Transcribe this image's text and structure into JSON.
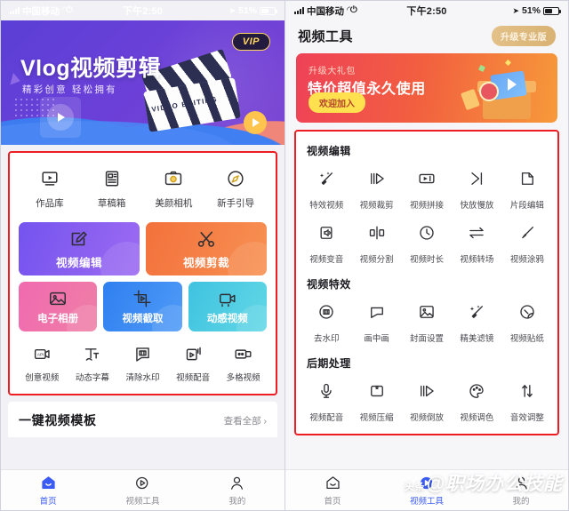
{
  "status_bar": {
    "carrier": "中国移动",
    "time": "下午2:50",
    "battery": "51%"
  },
  "left_screen": {
    "hero": {
      "title": "Vlog视频剪辑",
      "subtitle": "精彩创意 轻松拥有",
      "vip_badge": "VIP",
      "clapper_label": "VIDEO EDITING"
    },
    "quick_actions": [
      {
        "label": "作品库",
        "icon": "video-library-icon"
      },
      {
        "label": "草稿箱",
        "icon": "draft-box-icon"
      },
      {
        "label": "美颜相机",
        "icon": "beauty-camera-icon"
      },
      {
        "label": "新手引导",
        "icon": "compass-guide-icon"
      }
    ],
    "big_cards": [
      {
        "label": "视频编辑",
        "icon": "edit-pencil-icon",
        "color": "#7453ef"
      },
      {
        "label": "视频剪裁",
        "icon": "scissors-icon",
        "color": "#f3713c"
      }
    ],
    "mid_cards": [
      {
        "label": "电子相册",
        "icon": "photo-album-icon",
        "color": "#f06ab0"
      },
      {
        "label": "视频截取",
        "icon": "video-capture-icon",
        "color": "#2f7ff0"
      },
      {
        "label": "动感视频",
        "icon": "dynamic-video-icon",
        "color": "#3fc3e0"
      }
    ],
    "small_actions": [
      {
        "label": "创意视频",
        "icon": "creative-video-icon"
      },
      {
        "label": "动态字幕",
        "icon": "dynamic-subtitle-icon"
      },
      {
        "label": "清除水印",
        "icon": "remove-watermark-icon"
      },
      {
        "label": "视频配音",
        "icon": "video-dubbing-icon"
      },
      {
        "label": "多格视频",
        "icon": "multi-frame-video-icon"
      }
    ],
    "section": {
      "title": "一键视频模板",
      "more": "查看全部 ›"
    },
    "tabbar": [
      {
        "label": "首页",
        "icon": "home-icon",
        "active": true
      },
      {
        "label": "视频工具",
        "icon": "video-tools-icon",
        "active": false
      },
      {
        "label": "我的",
        "icon": "profile-icon",
        "active": false
      }
    ]
  },
  "right_screen": {
    "header": {
      "title": "视频工具",
      "upgrade_button": "升级专业版"
    },
    "promo": {
      "eyebrow": "升级大礼包",
      "headline": "特价超值永久使用",
      "button": "欢迎加入"
    },
    "groups": [
      {
        "title": "视频编辑",
        "items": [
          {
            "label": "特效视频",
            "icon": "magic-wand-icon"
          },
          {
            "label": "视频裁剪",
            "icon": "video-trim-icon"
          },
          {
            "label": "视频拼接",
            "icon": "video-merge-icon"
          },
          {
            "label": "快放慢放",
            "icon": "speed-icon"
          },
          {
            "label": "片段编辑",
            "icon": "clip-edit-icon"
          },
          {
            "label": "视频变音",
            "icon": "voice-change-icon"
          },
          {
            "label": "视频分割",
            "icon": "video-split-icon"
          },
          {
            "label": "视频时长",
            "icon": "clock-duration-icon"
          },
          {
            "label": "视频转场",
            "icon": "transition-icon"
          },
          {
            "label": "视频涂鸦",
            "icon": "brush-doodle-icon"
          }
        ]
      },
      {
        "title": "视频特效",
        "items": [
          {
            "label": "去水印",
            "icon": "watermark-remove-icon"
          },
          {
            "label": "画中画",
            "icon": "picture-in-picture-icon"
          },
          {
            "label": "封面设置",
            "icon": "cover-setting-icon"
          },
          {
            "label": "精美滤镜",
            "icon": "filter-sparkle-icon"
          },
          {
            "label": "视频贴纸",
            "icon": "sticker-icon"
          }
        ]
      },
      {
        "title": "后期处理",
        "items": [
          {
            "label": "视频配音",
            "icon": "microphone-icon"
          },
          {
            "label": "视频压缩",
            "icon": "compress-icon"
          },
          {
            "label": "视频倒放",
            "icon": "reverse-play-icon"
          },
          {
            "label": "视频调色",
            "icon": "color-palette-icon"
          },
          {
            "label": "音效调整",
            "icon": "audio-sliders-icon"
          }
        ]
      }
    ],
    "tabbar": [
      {
        "label": "首页",
        "icon": "home-icon",
        "active": false
      },
      {
        "label": "视频工具",
        "icon": "video-tools-icon",
        "active": true
      },
      {
        "label": "我的",
        "icon": "profile-icon",
        "active": false
      }
    ],
    "watermark": {
      "source": "头条",
      "account": "@职场办公技能"
    }
  }
}
